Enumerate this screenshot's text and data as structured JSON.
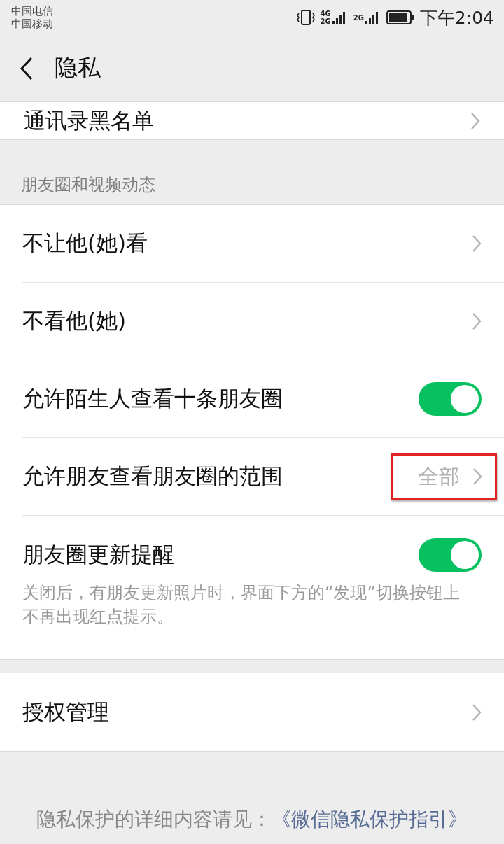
{
  "status_bar": {
    "carriers": [
      "中国电信",
      "中国移动"
    ],
    "time": "下午2:04",
    "network_1": "4G",
    "network_2": "2G",
    "network_3": "2G"
  },
  "header": {
    "title": "隐私"
  },
  "top_row": {
    "label": "通讯录黑名单"
  },
  "section": {
    "title": "朋友圈和视频动态",
    "items": [
      {
        "kind": "link",
        "label": "不让他(她)看"
      },
      {
        "kind": "link",
        "label": "不看他(她)"
      },
      {
        "kind": "toggle",
        "label": "允许陌生人查看十条朋友圈",
        "on": true
      },
      {
        "kind": "link",
        "label": "允许朋友查看朋友圈的范围",
        "value": "全部",
        "highlighted": true
      },
      {
        "kind": "toggle",
        "label": "朋友圈更新提醒",
        "on": true,
        "description": "关闭后，有朋友更新照片时，界面下方的“发现”切换按钮上不再出现红点提示。"
      }
    ]
  },
  "auth_row": {
    "label": "授权管理"
  },
  "footer": {
    "text": "隐私保护的详细内容请见：",
    "link": "《微信隐私保护指引》"
  }
}
